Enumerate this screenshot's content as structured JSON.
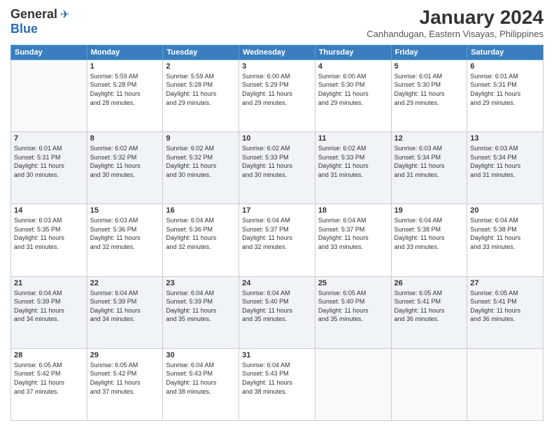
{
  "logo": {
    "line1": "General",
    "line2": "Blue"
  },
  "title": "January 2024",
  "subtitle": "Canhandugan, Eastern Visayas, Philippines",
  "headers": [
    "Sunday",
    "Monday",
    "Tuesday",
    "Wednesday",
    "Thursday",
    "Friday",
    "Saturday"
  ],
  "weeks": [
    [
      {
        "day": "",
        "info": ""
      },
      {
        "day": "1",
        "info": "Sunrise: 5:59 AM\nSunset: 5:28 PM\nDaylight: 11 hours\nand 28 minutes."
      },
      {
        "day": "2",
        "info": "Sunrise: 5:59 AM\nSunset: 5:28 PM\nDaylight: 11 hours\nand 29 minutes."
      },
      {
        "day": "3",
        "info": "Sunrise: 6:00 AM\nSunset: 5:29 PM\nDaylight: 11 hours\nand 29 minutes."
      },
      {
        "day": "4",
        "info": "Sunrise: 6:00 AM\nSunset: 5:30 PM\nDaylight: 11 hours\nand 29 minutes."
      },
      {
        "day": "5",
        "info": "Sunrise: 6:01 AM\nSunset: 5:30 PM\nDaylight: 11 hours\nand 29 minutes."
      },
      {
        "day": "6",
        "info": "Sunrise: 6:01 AM\nSunset: 5:31 PM\nDaylight: 11 hours\nand 29 minutes."
      }
    ],
    [
      {
        "day": "7",
        "info": "Sunrise: 6:01 AM\nSunset: 5:31 PM\nDaylight: 11 hours\nand 30 minutes."
      },
      {
        "day": "8",
        "info": "Sunrise: 6:02 AM\nSunset: 5:32 PM\nDaylight: 11 hours\nand 30 minutes."
      },
      {
        "day": "9",
        "info": "Sunrise: 6:02 AM\nSunset: 5:32 PM\nDaylight: 11 hours\nand 30 minutes."
      },
      {
        "day": "10",
        "info": "Sunrise: 6:02 AM\nSunset: 5:33 PM\nDaylight: 11 hours\nand 30 minutes."
      },
      {
        "day": "11",
        "info": "Sunrise: 6:02 AM\nSunset: 5:33 PM\nDaylight: 11 hours\nand 31 minutes."
      },
      {
        "day": "12",
        "info": "Sunrise: 6:03 AM\nSunset: 5:34 PM\nDaylight: 11 hours\nand 31 minutes."
      },
      {
        "day": "13",
        "info": "Sunrise: 6:03 AM\nSunset: 5:34 PM\nDaylight: 11 hours\nand 31 minutes."
      }
    ],
    [
      {
        "day": "14",
        "info": "Sunrise: 6:03 AM\nSunset: 5:35 PM\nDaylight: 11 hours\nand 31 minutes."
      },
      {
        "day": "15",
        "info": "Sunrise: 6:03 AM\nSunset: 5:36 PM\nDaylight: 11 hours\nand 32 minutes."
      },
      {
        "day": "16",
        "info": "Sunrise: 6:04 AM\nSunset: 5:36 PM\nDaylight: 11 hours\nand 32 minutes."
      },
      {
        "day": "17",
        "info": "Sunrise: 6:04 AM\nSunset: 5:37 PM\nDaylight: 11 hours\nand 32 minutes."
      },
      {
        "day": "18",
        "info": "Sunrise: 6:04 AM\nSunset: 5:37 PM\nDaylight: 11 hours\nand 33 minutes."
      },
      {
        "day": "19",
        "info": "Sunrise: 6:04 AM\nSunset: 5:38 PM\nDaylight: 11 hours\nand 33 minutes."
      },
      {
        "day": "20",
        "info": "Sunrise: 6:04 AM\nSunset: 5:38 PM\nDaylight: 11 hours\nand 33 minutes."
      }
    ],
    [
      {
        "day": "21",
        "info": "Sunrise: 6:04 AM\nSunset: 5:39 PM\nDaylight: 11 hours\nand 34 minutes."
      },
      {
        "day": "22",
        "info": "Sunrise: 6:04 AM\nSunset: 5:39 PM\nDaylight: 11 hours\nand 34 minutes."
      },
      {
        "day": "23",
        "info": "Sunrise: 6:04 AM\nSunset: 5:39 PM\nDaylight: 11 hours\nand 35 minutes."
      },
      {
        "day": "24",
        "info": "Sunrise: 6:04 AM\nSunset: 5:40 PM\nDaylight: 11 hours\nand 35 minutes."
      },
      {
        "day": "25",
        "info": "Sunrise: 6:05 AM\nSunset: 5:40 PM\nDaylight: 11 hours\nand 35 minutes."
      },
      {
        "day": "26",
        "info": "Sunrise: 6:05 AM\nSunset: 5:41 PM\nDaylight: 11 hours\nand 36 minutes."
      },
      {
        "day": "27",
        "info": "Sunrise: 6:05 AM\nSunset: 5:41 PM\nDaylight: 11 hours\nand 36 minutes."
      }
    ],
    [
      {
        "day": "28",
        "info": "Sunrise: 6:05 AM\nSunset: 5:42 PM\nDaylight: 11 hours\nand 37 minutes."
      },
      {
        "day": "29",
        "info": "Sunrise: 6:05 AM\nSunset: 5:42 PM\nDaylight: 11 hours\nand 37 minutes."
      },
      {
        "day": "30",
        "info": "Sunrise: 6:04 AM\nSunset: 5:43 PM\nDaylight: 11 hours\nand 38 minutes."
      },
      {
        "day": "31",
        "info": "Sunrise: 6:04 AM\nSunset: 5:43 PM\nDaylight: 11 hours\nand 38 minutes."
      },
      {
        "day": "",
        "info": ""
      },
      {
        "day": "",
        "info": ""
      },
      {
        "day": "",
        "info": ""
      }
    ]
  ],
  "row_classes": [
    "row-white",
    "row-shaded",
    "row-white",
    "row-shaded",
    "row-white"
  ]
}
